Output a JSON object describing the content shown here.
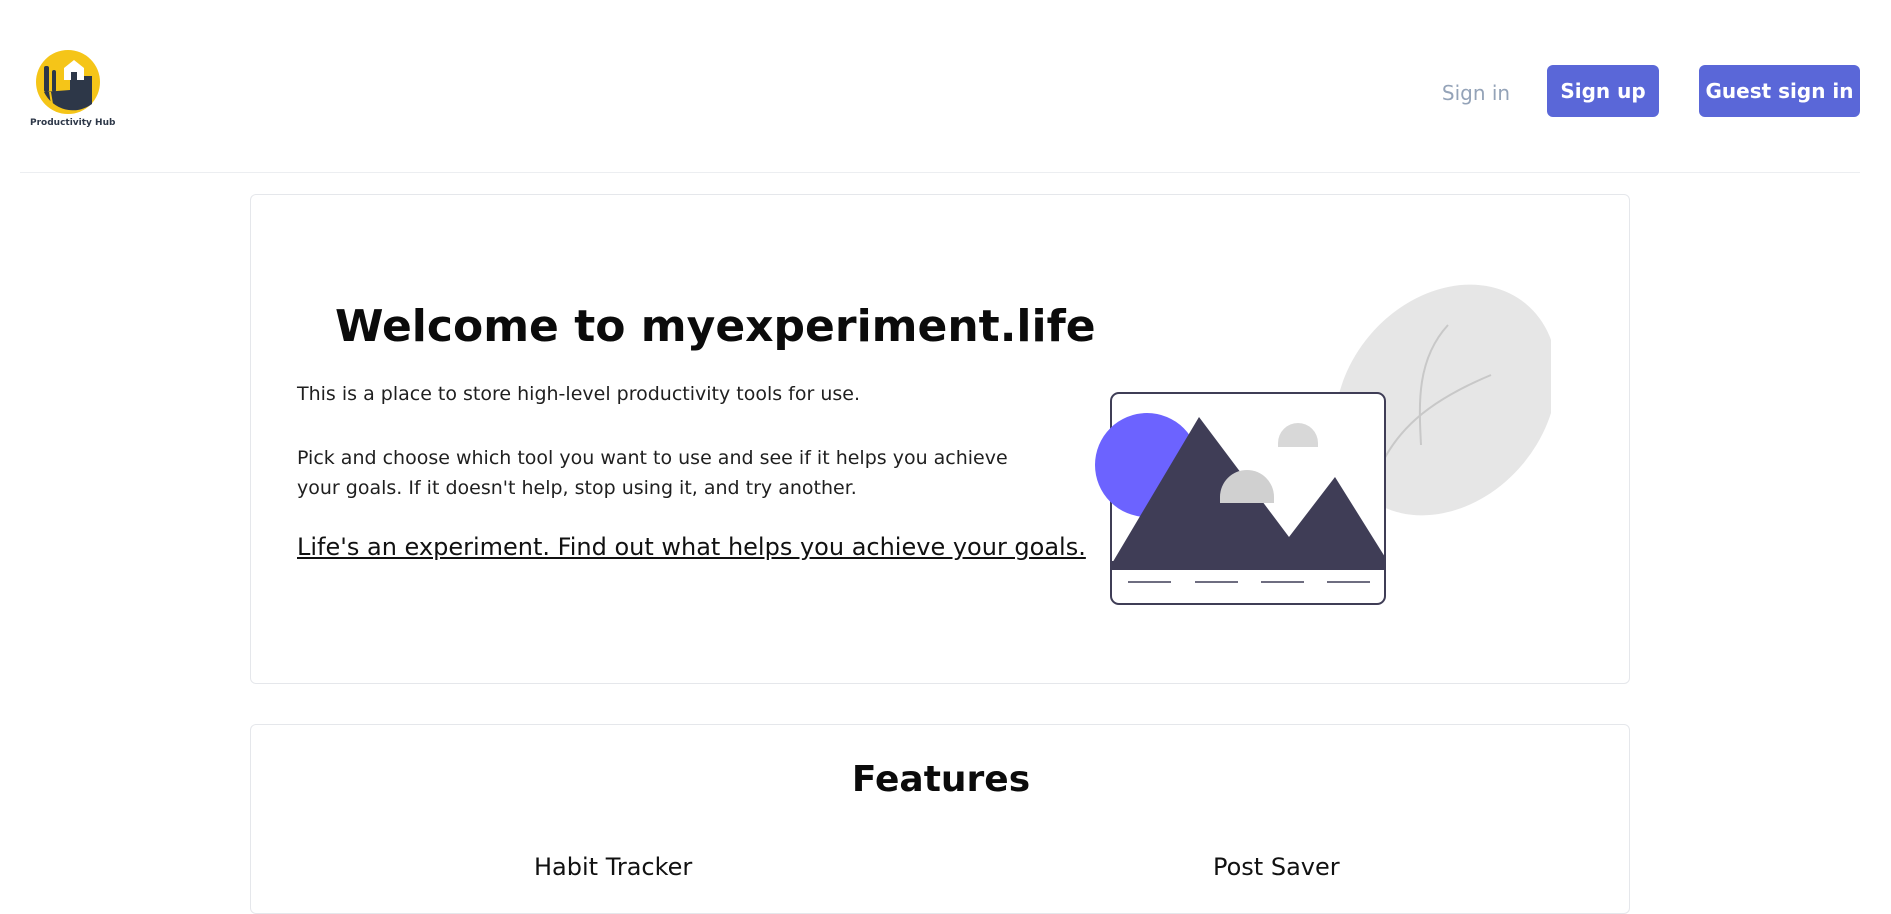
{
  "header": {
    "logo_text": "Productivity Hub",
    "signin_label": "Sign in",
    "signup_label": "Sign up",
    "guest_signin_label": "Guest sign in"
  },
  "hero": {
    "title": "Welcome to myexperiment.life",
    "paragraph_1": "This is a place to store high-level productivity tools for use.",
    "paragraph_2": "Pick and choose which tool you want to use and see if it helps you achieve your goals. If it doesn't help, stop using it, and try another.",
    "link_text": "Life's an experiment. Find out what helps you achieve your goals.",
    "illustration_icon": "landscape-image-illustration"
  },
  "features": {
    "title": "Features",
    "items": [
      {
        "name": "Habit Tracker"
      },
      {
        "name": "Post Saver"
      }
    ]
  },
  "colors": {
    "primary_button": "#5a67d8",
    "muted_link": "#94a3b8",
    "illustration_accent": "#6c63ff",
    "illustration_dark": "#3f3d56"
  }
}
